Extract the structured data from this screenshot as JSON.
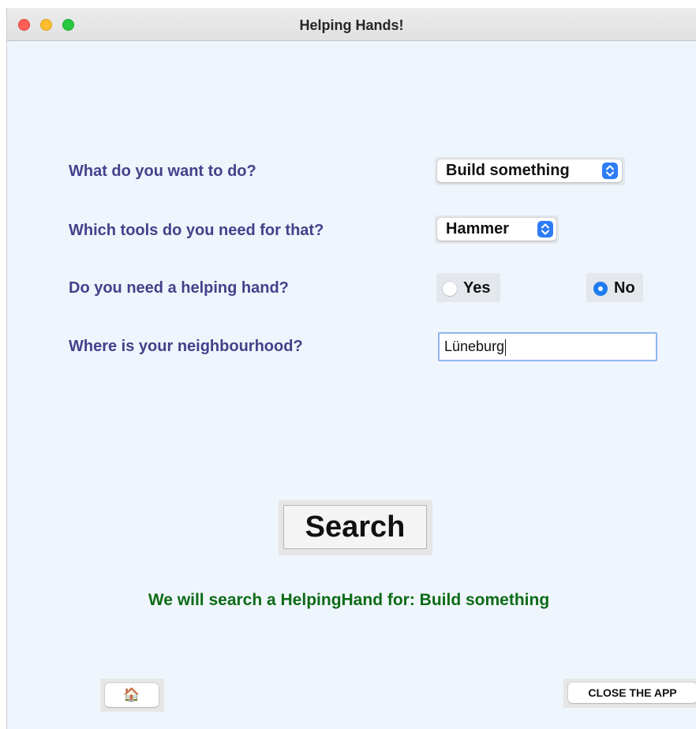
{
  "window": {
    "title": "Helping Hands!"
  },
  "form": {
    "activity": {
      "label": "What do you want to do?",
      "selected": "Build something"
    },
    "tools": {
      "label": "Which tools do you need for that?",
      "selected": "Hammer"
    },
    "helping_hand": {
      "label": "Do you need a helping hand?",
      "yes_label": "Yes",
      "no_label": "No",
      "selected": "No"
    },
    "neighbourhood": {
      "label": "Where is your neighbourhood?",
      "value": "Lüneburg"
    }
  },
  "search": {
    "label": "Search"
  },
  "result": {
    "text": "We will search a HelpingHand for: Build something"
  },
  "footer": {
    "home_icon": "🏠",
    "close_label": "CLOSE THE APP"
  },
  "colors": {
    "label": "#44418a",
    "result": "#0c6b16",
    "accent": "#2e7cf6",
    "background": "#eff5fd"
  },
  "icons": {
    "home": "house-icon",
    "popup": "chevron-updown-icon"
  }
}
